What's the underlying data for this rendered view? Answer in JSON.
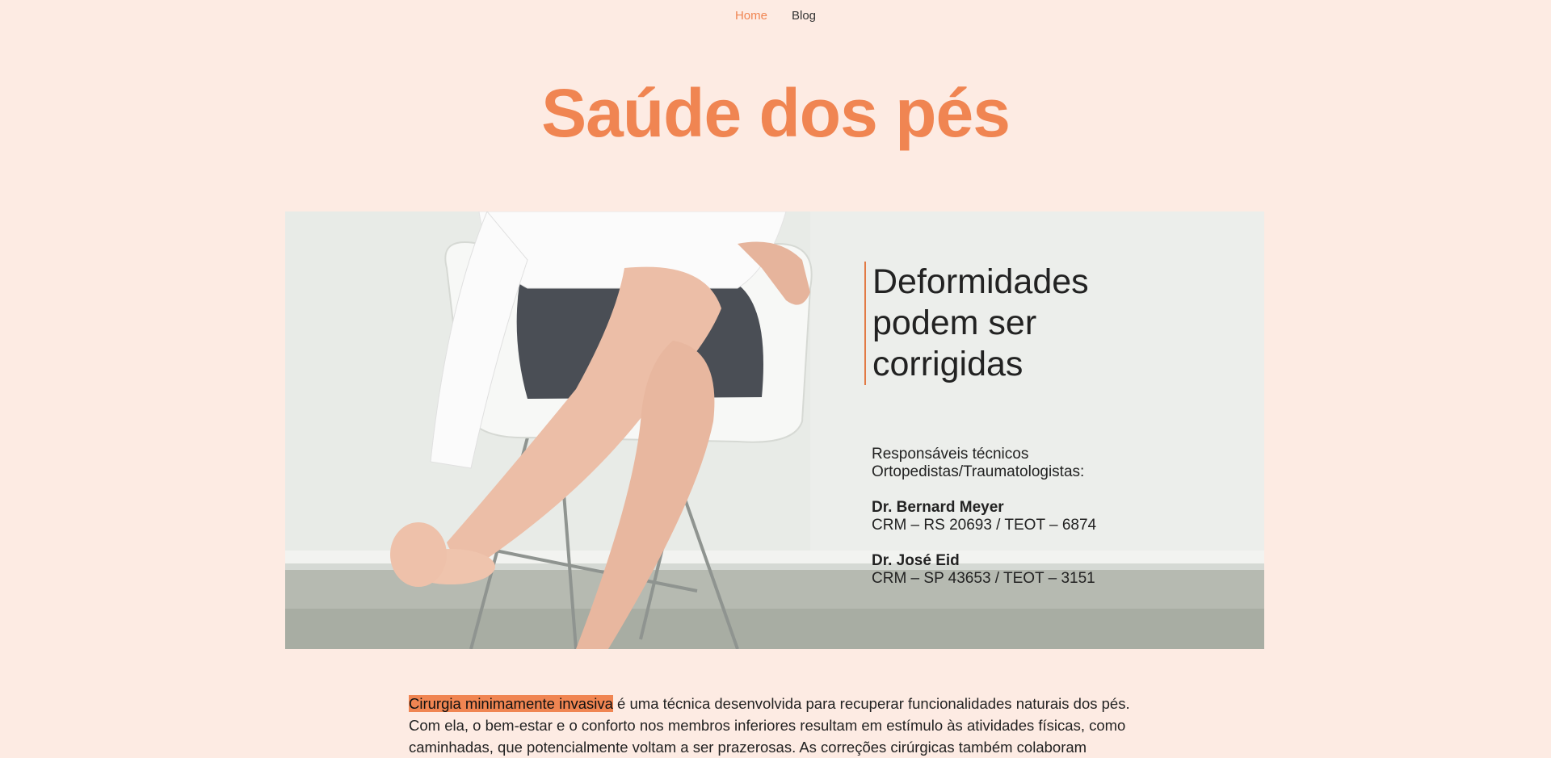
{
  "nav": {
    "items": [
      {
        "label": "Home",
        "active": true
      },
      {
        "label": "Blog",
        "active": false
      }
    ],
    "accent_color": "#f08552"
  },
  "page": {
    "title": "Saúde dos pés",
    "background_color": "#fdebe3"
  },
  "hero": {
    "image_alt": "Mulher sentada em cadeira branca segurando o pé",
    "heading_lines": [
      "Deformidades",
      "podem ser",
      "corrigidas"
    ],
    "credits": {
      "title_line_1": "Responsáveis técnicos",
      "title_line_2": "Ortopedistas/Traumatologistas:",
      "doctors": [
        {
          "name": "Dr. Bernard Meyer",
          "registry": "CRM – RS 20693 / TEOT – 6874"
        },
        {
          "name": "Dr. José Eid",
          "registry": "CRM – SP 43653 / TEOT – 3151"
        }
      ]
    }
  },
  "intro": {
    "highlight": "Cirurgia minimamente invasiva",
    "text": " é uma técnica desenvolvida para recuperar funcionalidades naturais dos pés. Com ela, o bem-estar e o conforto nos membros inferiores resultam em estímulo às atividades físicas, como caminhadas, que potencialmente voltam a ser prazerosas. As correções cirúrgicas também colaboram"
  }
}
